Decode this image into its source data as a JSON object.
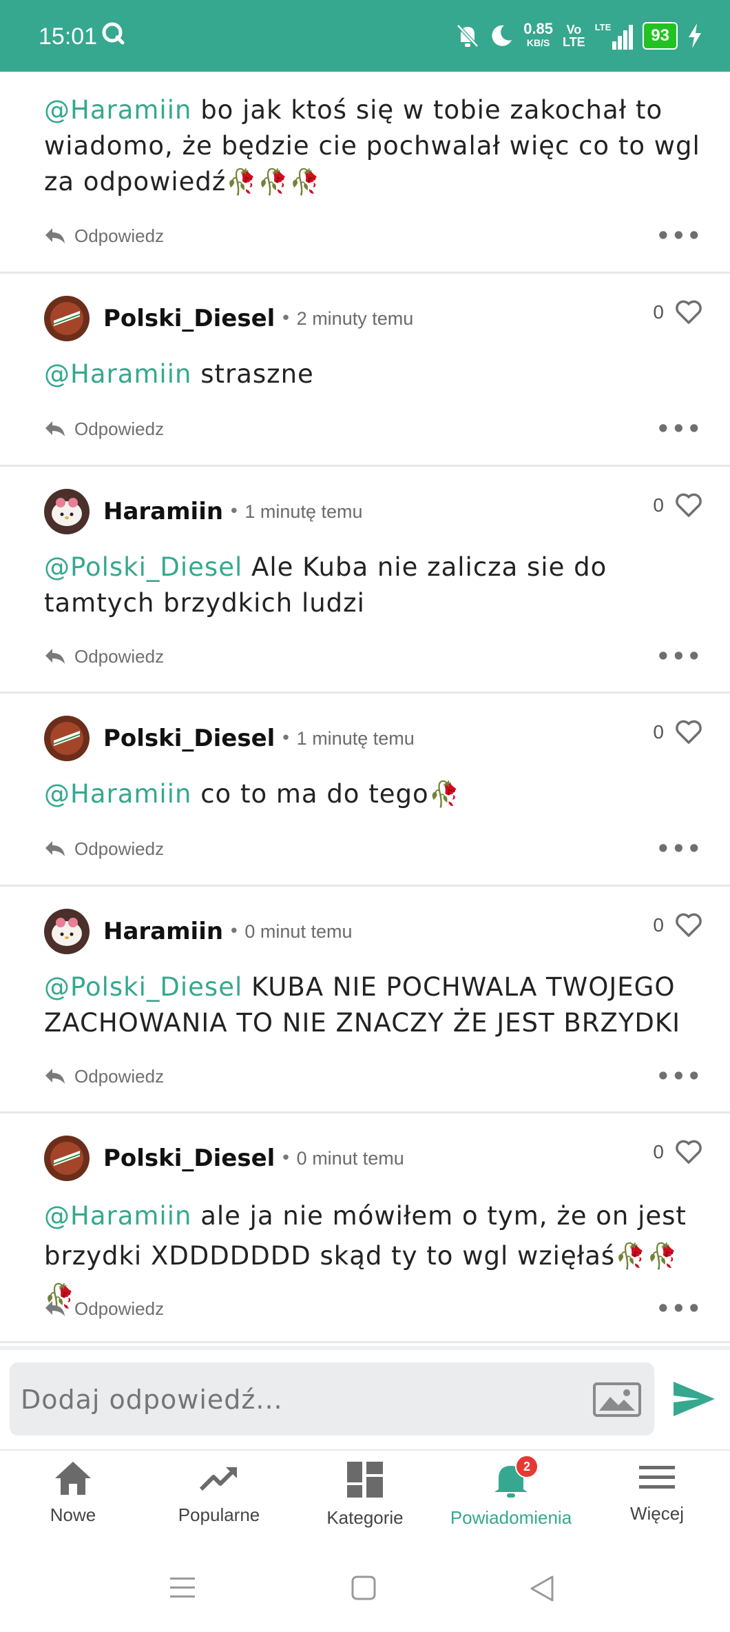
{
  "status_bar": {
    "time": "15:01",
    "net_speed": "0.85",
    "net_unit": "KB/S",
    "volte_top": "Vo",
    "volte_bottom": "LTE",
    "lte": "LTE",
    "battery": "93"
  },
  "comments": [
    {
      "mention": "@Haramiin",
      "text": " bo jak ktoś się w tobie zakochał to wiadomo, że będzie cie pochwalał więc co to wgl za odpowiedź",
      "roses": "🥀🥀🥀",
      "reply_label": "Odpowiedz"
    },
    {
      "user": "Polski_Diesel",
      "time": "2 minuty temu",
      "likes": "0",
      "mention": "@Haramiin",
      "text": " straszne",
      "roses": "",
      "reply_label": "Odpowiedz"
    },
    {
      "user": "Haramiin",
      "time": "1 minutę temu",
      "likes": "0",
      "mention": "@Polski_Diesel",
      "text": " Ale Kuba nie zalicza sie do tamtych brzydkich ludzi",
      "roses": "",
      "reply_label": "Odpowiedz"
    },
    {
      "user": "Polski_Diesel",
      "time": "1 minutę temu",
      "likes": "0",
      "mention": "@Haramiin",
      "text": " co to ma do tego",
      "roses": "🥀",
      "reply_label": "Odpowiedz"
    },
    {
      "user": "Haramiin",
      "time": "0 minut temu",
      "likes": "0",
      "mention": "@Polski_Diesel",
      "text": " KUBA NIE POCHWALA TWOJEGO ZACHOWANIA TO NIE ZNACZY ŻE JEST BRZYDKI",
      "roses": "",
      "reply_label": "Odpowiedz"
    },
    {
      "user": "Polski_Diesel",
      "time": "0 minut temu",
      "likes": "0",
      "mention": "@Haramiin",
      "text": " ale ja nie mówiłem o tym, że on jest brzydki XDDDDDDD skąd ty to wgl wzięłaś",
      "roses": "🥀🥀🥀",
      "reply_label": "Odpowiedz"
    }
  ],
  "reply_input": {
    "placeholder": "Dodaj odpowiedź..."
  },
  "bottom_nav": {
    "items": [
      {
        "label": "Nowe",
        "icon": "home-icon"
      },
      {
        "label": "Popularne",
        "icon": "trending-icon"
      },
      {
        "label": "Kategorie",
        "icon": "dashboard-icon"
      },
      {
        "label": "Powiadomienia",
        "icon": "bell-icon",
        "badge": "2",
        "active": true
      },
      {
        "label": "Więcej",
        "icon": "menu-icon"
      }
    ]
  },
  "colors": {
    "accent": "#35a88f",
    "status_bar": "#35a88f",
    "badge": "#e53935",
    "battery": "#23c223"
  }
}
